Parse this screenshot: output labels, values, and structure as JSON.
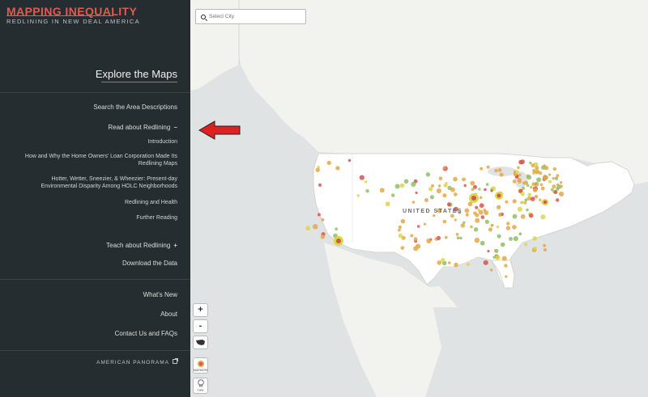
{
  "brand": {
    "title": "MAPPING INEQUALITY",
    "subtitle": "REDLINING IN NEW DEAL AMERICA"
  },
  "sidebar": {
    "heading": "Explore the Maps",
    "items": [
      {
        "label": "Search the Area Descriptions"
      },
      {
        "label": "Read about Redlining",
        "toggle": "−"
      },
      {
        "label": "Teach about Redlining",
        "toggle": "+"
      },
      {
        "label": "Download the Data"
      },
      {
        "label": "What's New"
      },
      {
        "label": "About"
      },
      {
        "label": "Contact Us and FAQs"
      },
      {
        "label": "AMERICAN PANORAMA"
      }
    ],
    "subitems": [
      {
        "label": "Introduction"
      },
      {
        "line1": "How and Why the Home Owners' Loan Corporation Made Its",
        "line2": "Redlining Maps"
      },
      {
        "line1": "Hotter, Wetter, Sneezier, & Wheezier: Present-day",
        "line2": "Environmental Disparity Among HOLC Neighborhoods"
      },
      {
        "label": "Redlining and Health"
      },
      {
        "label": "Further Reading"
      }
    ]
  },
  "search": {
    "placeholder": "Select City"
  },
  "map": {
    "country_label": "UNITED STATES"
  },
  "controls": {
    "zoom_in": "+",
    "zoom_out": "-",
    "markers_label": "MARKERS",
    "tips_label": "TIPS"
  },
  "colors": {
    "sidebar_bg": "#262d31",
    "accent": "#e15a4f",
    "arrow": "#e02020",
    "dot_orange": "#e4a84a",
    "dot_yellow": "#d8d84a",
    "dot_green": "#8fbf6a",
    "dot_red": "#d9534f"
  }
}
